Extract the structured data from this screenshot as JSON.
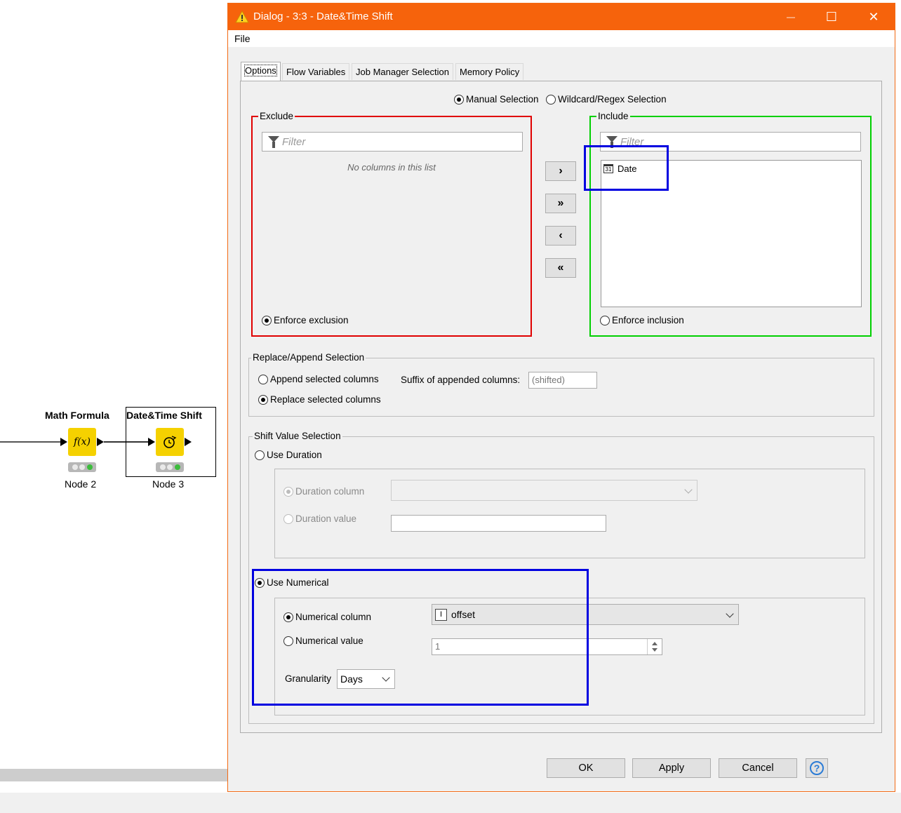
{
  "workflow": {
    "node_math": {
      "title": "Math Formula",
      "label": "Node 2",
      "icon": "fx-icon"
    },
    "node_shift": {
      "title": "Date&Time Shift",
      "label": "Node 3",
      "icon": "clock-shift-icon"
    }
  },
  "dialog": {
    "title": "Dialog - 3:3 - Date&Time Shift",
    "title_icon": "warning-triangle-icon",
    "window_buttons": {
      "minimize": "—",
      "maximize": "☐",
      "close": "✕"
    },
    "menu": {
      "file": "File"
    },
    "tabs": [
      {
        "label": "Options",
        "active": true
      },
      {
        "label": "Flow Variables",
        "active": false
      },
      {
        "label": "Job Manager Selection",
        "active": false
      },
      {
        "label": "Memory Policy",
        "active": false
      }
    ],
    "selection_mode": {
      "manual": "Manual Selection",
      "wildcard": "Wildcard/Regex Selection",
      "selected": "manual"
    },
    "exclude": {
      "legend": "Exclude",
      "filter_placeholder": "Filter",
      "empty_text": "No columns in this list",
      "enforce": "Enforce exclusion",
      "border_color": "#e00000"
    },
    "include": {
      "legend": "Include",
      "filter_placeholder": "Filter",
      "items": [
        {
          "label": "Date",
          "icon": "calendar-icon",
          "icon_text": "31"
        }
      ],
      "enforce": "Enforce inclusion",
      "border_color": "#00d000"
    },
    "move_buttons": {
      "add": "›",
      "add_all": "»",
      "remove": "‹",
      "remove_all": "«"
    },
    "replace_append": {
      "legend": "Replace/Append Selection",
      "append": "Append selected columns",
      "replace": "Replace selected columns",
      "selected": "replace",
      "suffix_label": "Suffix of appended columns:",
      "suffix_value": "(shifted)"
    },
    "shift_value": {
      "legend": "Shift Value Selection",
      "use_duration": "Use Duration",
      "duration_column": "Duration column",
      "duration_value": "Duration value",
      "use_numerical": "Use Numerical",
      "numerical_column": "Numerical column",
      "numerical_column_value": "offset",
      "numerical_column_icon": "integer-column-icon",
      "numerical_column_icon_text": "I",
      "numerical_value": "Numerical value",
      "numerical_value_value": "1",
      "granularity_label": "Granularity",
      "granularity_value": "Days",
      "selected": "numerical"
    },
    "buttons": {
      "ok": "OK",
      "apply": "Apply",
      "cancel": "Cancel",
      "help": "?"
    },
    "colors": {
      "titlebar": "#f6630c",
      "highlight": "#0000e0"
    }
  }
}
